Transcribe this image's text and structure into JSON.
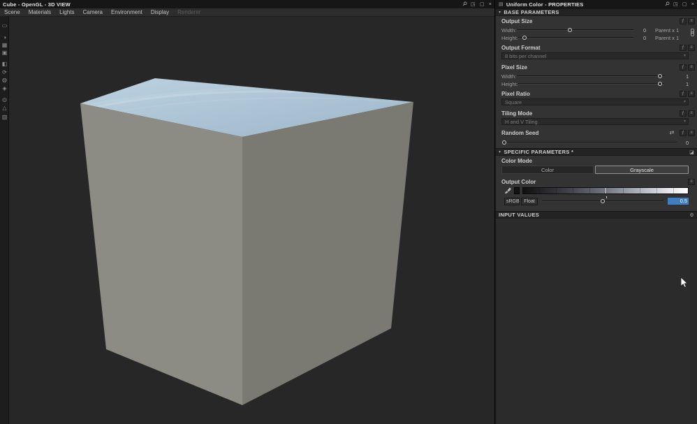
{
  "window": {
    "title": "Cube - OpenGL - 3D VIEW",
    "menus": [
      "Scene",
      "Materials",
      "Lights",
      "Camera",
      "Environment",
      "Display"
    ],
    "disabled_menu": "Renderer"
  },
  "icons": {
    "pin": "⚲",
    "float": "◳",
    "maximize": "▢",
    "close": "×",
    "chevron": "▾",
    "gear": "⚙",
    "shuffle": "⇄",
    "fx": "ƒ",
    "menu": "≡",
    "preset": "◪",
    "arrow": "▾",
    "panel": "▤"
  },
  "left_toolbar": [
    {
      "name": "select",
      "glyph": "▭"
    },
    {
      "name": "light",
      "glyph": "◑"
    },
    {
      "name": "image",
      "glyph": "▦"
    },
    {
      "name": "shape",
      "glyph": "▣"
    },
    {
      "name": "material",
      "glyph": "◧"
    },
    {
      "name": "rotate",
      "glyph": "⟳"
    },
    {
      "name": "environment",
      "glyph": "◍"
    },
    {
      "name": "mesh",
      "glyph": "◈"
    },
    {
      "name": "view",
      "glyph": "◎"
    },
    {
      "name": "axis",
      "glyph": "△"
    },
    {
      "name": "stats",
      "glyph": "▥"
    }
  ],
  "properties": {
    "title": "Uniform Color - PROPERTIES",
    "base": {
      "header": "BASE PARAMETERS",
      "output_size": {
        "label": "Output Size",
        "width_label": "Width:",
        "width_value": "0",
        "width_pos": 45,
        "height_label": "Height:",
        "height_value": "0",
        "height_pos": 6,
        "width_mode": "Parent x 1",
        "height_mode": "Parent x 1"
      },
      "output_format": {
        "label": "Output Format",
        "value": "8 bits per channel"
      },
      "pixel_size": {
        "label": "Pixel Size",
        "width_label": "Width:",
        "width_value": "1",
        "width_pos": 97,
        "height_label": "Height:",
        "height_value": "1",
        "height_pos": 97
      },
      "pixel_ratio": {
        "label": "Pixel Ratio",
        "value": "Square"
      },
      "tiling_mode": {
        "label": "Tiling Mode",
        "value": "H and V Tiling"
      },
      "random_seed": {
        "label": "Random Seed",
        "value": "0",
        "pos": 1
      }
    },
    "specific": {
      "header": "SPECIFIC PARAMETERS *",
      "color_mode": {
        "label": "Color Mode",
        "color": "Color",
        "grayscale": "Grayscale"
      },
      "output_color": {
        "label": "Output Color",
        "srgb": "sRGB",
        "float": "Float",
        "value": "0.5",
        "pos": 50
      }
    },
    "input_values": {
      "header": "INPUT VALUES"
    }
  },
  "viewport": {
    "background": "#272727",
    "cube": {
      "top_color_1": "#bdd2e0",
      "top_color_2": "#9cb6ca",
      "left_color": "#8c8c84",
      "right_color": "#7a7a72"
    }
  }
}
